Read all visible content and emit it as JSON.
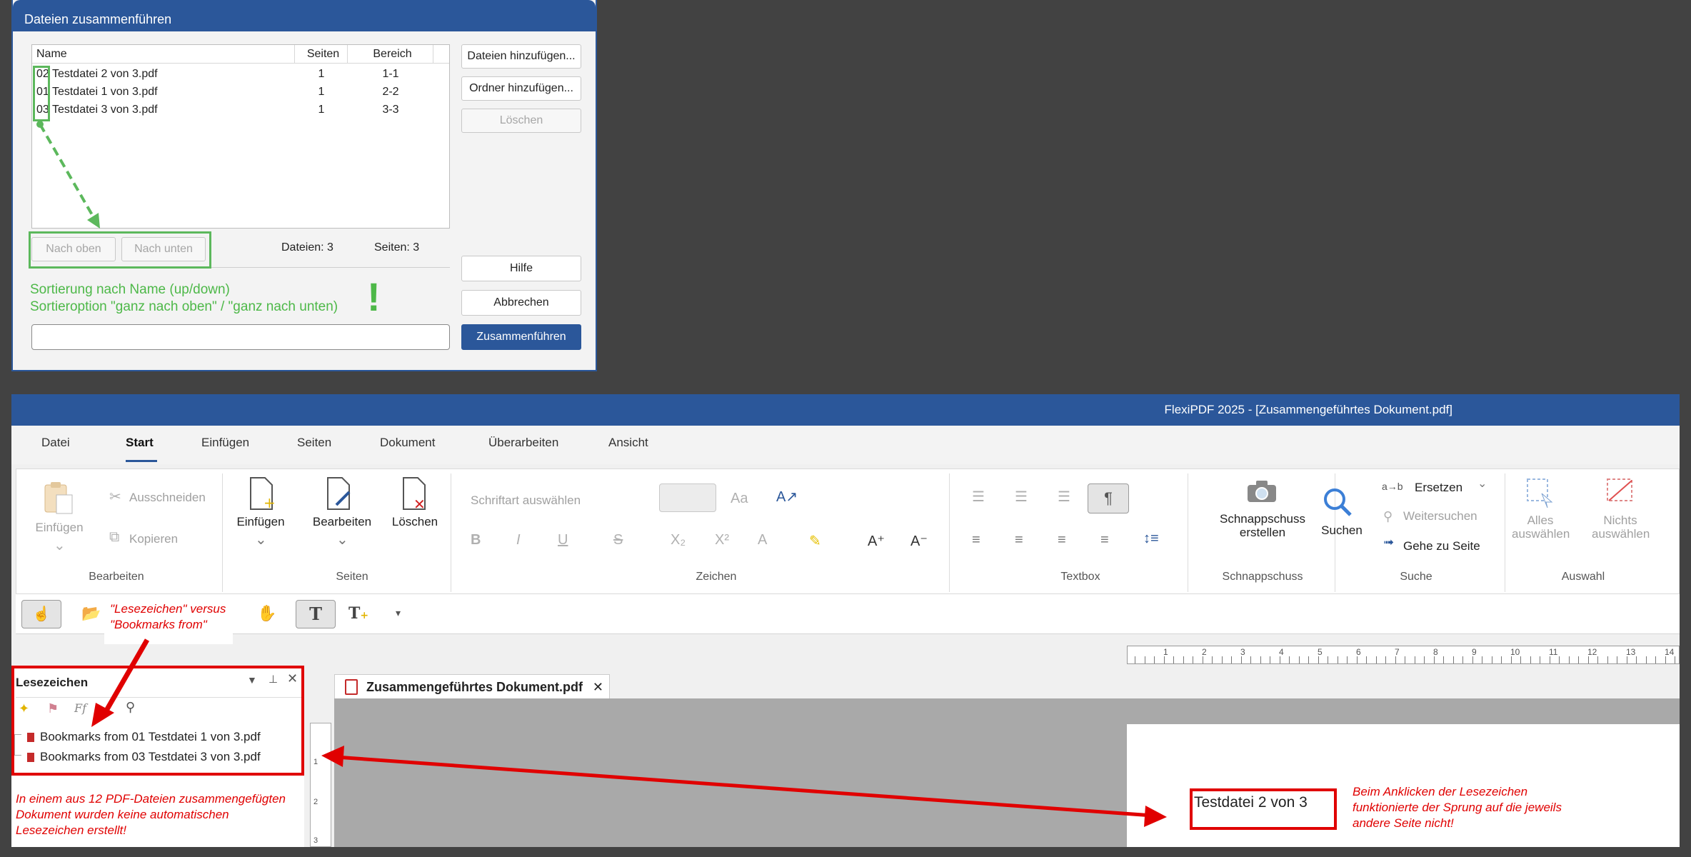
{
  "dialog": {
    "title": "Dateien zusammenführen",
    "columns": {
      "name": "Name",
      "pages": "Seiten",
      "range": "Bereich"
    },
    "files": [
      {
        "name": "02 Testdatei 2 von 3.pdf",
        "pages": "1",
        "range": "1-1"
      },
      {
        "name": "01 Testdatei 1 von 3.pdf",
        "pages": "1",
        "range": "2-2"
      },
      {
        "name": "03 Testdatei 3 von 3.pdf",
        "pages": "1",
        "range": "3-3"
      }
    ],
    "buttons": {
      "add_files": "Dateien hinzufügen...",
      "add_folder": "Ordner hinzufügen...",
      "delete": "Löschen",
      "up": "Nach oben",
      "down": "Nach unten",
      "help": "Hilfe",
      "cancel": "Abbrechen",
      "merge": "Zusammenführen"
    },
    "stats": {
      "files": "Dateien: 3",
      "pages": "Seiten: 3"
    },
    "note_line1": "Sortierung nach Name (up/down)",
    "note_line2": "Sortieroption \"ganz nach oben\" / \"ganz nach unten)",
    "exclamation": "!"
  },
  "app": {
    "title": "FlexiPDF 2025 - [Zusammengeführtes Dokument.pdf]",
    "menu": [
      "Datei",
      "Start",
      "Einfügen",
      "Seiten",
      "Dokument",
      "Überarbeiten",
      "Ansicht"
    ],
    "ribbon": {
      "einfuegen_clip": "Einfügen",
      "ausschneiden": "Ausschneiden",
      "kopieren": "Kopieren",
      "grp_bearbeiten": "Bearbeiten",
      "pg_einfuegen": "Einfügen",
      "pg_bearbeiten": "Bearbeiten",
      "pg_loeschen": "Löschen",
      "grp_seiten": "Seiten",
      "font_placeholder": "Schriftart auswählen",
      "grp_zeichen": "Zeichen",
      "grp_textbox": "Textbox",
      "snap_line1": "Schnappschuss",
      "snap_line2": "erstellen",
      "grp_schnappschuss": "Schnappschuss",
      "suchen": "Suchen",
      "ersetzen": "Ersetzen",
      "weitersuchen": "Weitersuchen",
      "gehe_zu": "Gehe zu Seite",
      "grp_suche": "Suche",
      "alles1": "Alles",
      "alles2": "auswählen",
      "nichts1": "Nichts",
      "nichts2": "auswählen",
      "grp_auswahl": "Auswahl"
    },
    "ruler_numbers": [
      "1",
      "2",
      "3",
      "4",
      "5",
      "6",
      "7",
      "8",
      "9",
      "10",
      "11",
      "12",
      "13",
      "14"
    ],
    "vruler_numbers": [
      "1",
      "2",
      "3"
    ],
    "panel": {
      "title": "Lesezeichen",
      "bookmarks": [
        "Bookmarks from 01 Testdatei 1 von 3.pdf",
        "Bookmarks from 03 Testdatei 3 von 3.pdf"
      ]
    },
    "doc_tab": "Zusammengeführtes Dokument.pdf",
    "page_text": "Testdatei 2 von 3"
  },
  "annotations": {
    "lesezeichen_note": "\"Lesezeichen\" versus \"Bookmarks from\"",
    "missing_bookmarks_note": "In einem aus 12 PDF-Dateien zusammengefügten Dokument wurden keine automatischen Lesezeichen erstellt!",
    "jump_note": "Beim Anklicken der Lesezeichen funktionierte der Sprung auf die jeweils andere Seite nicht!"
  },
  "colors": {
    "accent": "#2b579a",
    "annotation_red": "#e00000",
    "annotation_green": "#4db848"
  }
}
